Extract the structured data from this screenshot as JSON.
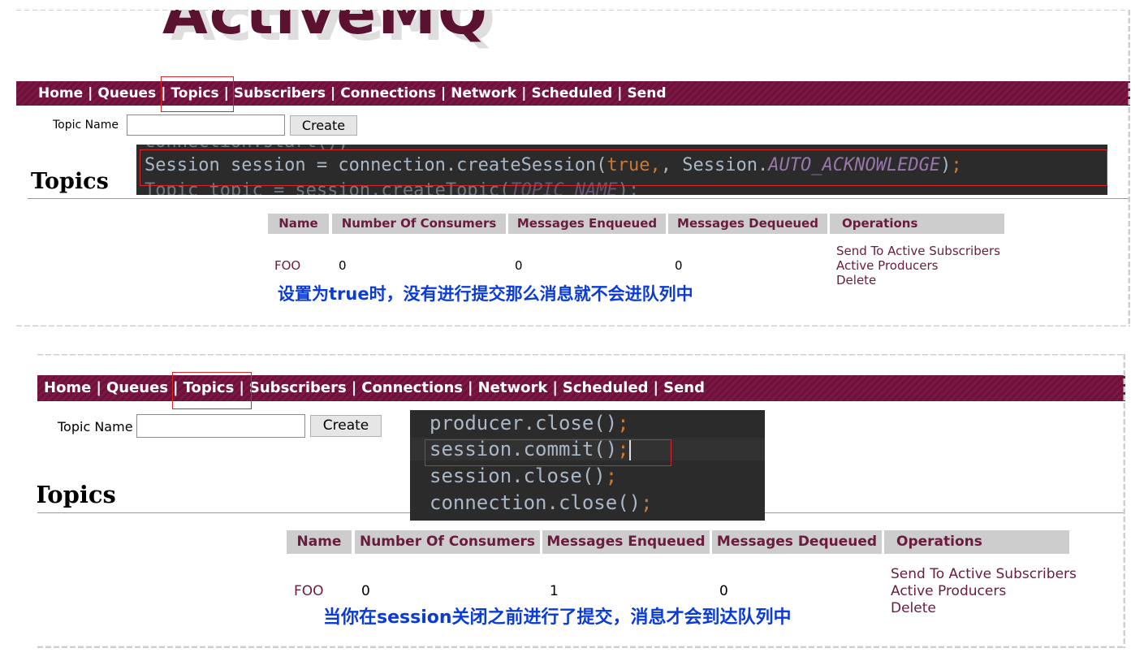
{
  "panel1": {
    "logo_text": "ActiveMQ",
    "nav": [
      "Home",
      "Queues",
      "Topics",
      "Subscribers",
      "Connections",
      "Network",
      "Scheduled",
      "Send"
    ],
    "topic_name_label": "Topic Name",
    "topic_name_value": "",
    "create_label": "Create",
    "heading": "Topics",
    "code_lines": {
      "prev": "connection.start();",
      "main_a": "Session session = connection.createSession(",
      "main_true": "true",
      "main_b": ", Session.",
      "main_const": "AUTO_ACKNOWLEDGE",
      "main_c": ");",
      "next_a": "Topic topic = session.createTopic(",
      "next_const": "TOPIC_NAME",
      "next_b": ");"
    },
    "table": {
      "headers": [
        "Name",
        "Number Of Consumers",
        "Messages Enqueued",
        "Messages Dequeued",
        "Operations"
      ],
      "row": {
        "name": "FOO",
        "consumers": "0",
        "enqueued": "0",
        "dequeued": "0"
      },
      "operations": [
        "Send To Active Subscribers",
        "Active Producers",
        "Delete"
      ]
    },
    "annotation": "设置为true时，没有进行提交那么消息就不会进队列中"
  },
  "panel2": {
    "nav": [
      "Home",
      "Queues",
      "Topics",
      "Subscribers",
      "Connections",
      "Network",
      "Scheduled",
      "Send"
    ],
    "topic_name_label": "Topic Name",
    "topic_name_value": "",
    "create_label": "Create",
    "heading": "Topics",
    "code_lines": {
      "l1_a": "producer.close()",
      "l2_a": "session.commit()",
      "l3_a": "session.close()",
      "l4_a": "connection.close()",
      "semi": ";"
    },
    "table": {
      "headers": [
        "Name",
        "Number Of Consumers",
        "Messages Enqueued",
        "Messages Dequeued",
        "Operations"
      ],
      "row": {
        "name": "FOO",
        "consumers": "0",
        "enqueued": "1",
        "dequeued": "0"
      },
      "operations": [
        "Send To Active Subscribers",
        "Active Producers",
        "Delete"
      ]
    },
    "annotation": "当你在session关闭之前进行了提交，消息才会到达队列中"
  },
  "colors": {
    "nav_bg": "#7b1744",
    "link": "#6b1b3f",
    "highlight_box": "#d9262b",
    "annotation": "#0a3bd6",
    "code_bg": "#2b2b2b",
    "code_keyword": "#cc7832",
    "code_constant": "#9876aa"
  }
}
